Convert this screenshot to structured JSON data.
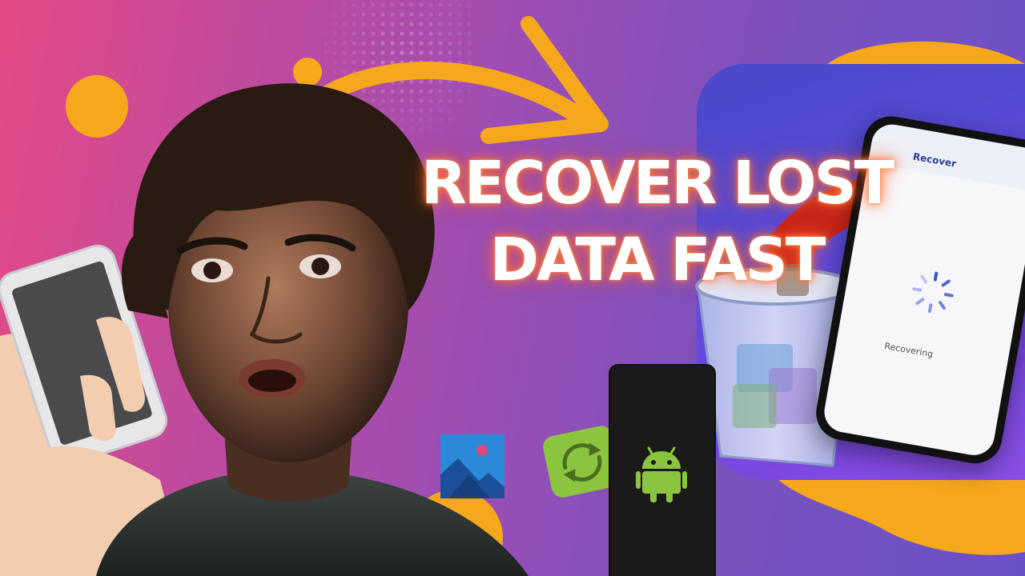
{
  "headline": {
    "line1": "RECOVER LOST",
    "line2": "DATA FAST"
  },
  "recover_phone": {
    "title": "Recover",
    "status": "Recovering"
  },
  "icons": {
    "gallery": "gallery-icon",
    "sync": "sync-icon",
    "android": "android-icon",
    "trash": "trash-bin-icon",
    "spinner": "loading-spinner-icon"
  },
  "colors": {
    "background_left": "#e54a86",
    "background_right": "#6a50c8",
    "accent_orange": "#f5a81c",
    "headline_text": "#ffffff",
    "headline_glow": "#ff7a3c",
    "recover_arrow": "#c8261c",
    "android_green": "#8bc53f"
  }
}
